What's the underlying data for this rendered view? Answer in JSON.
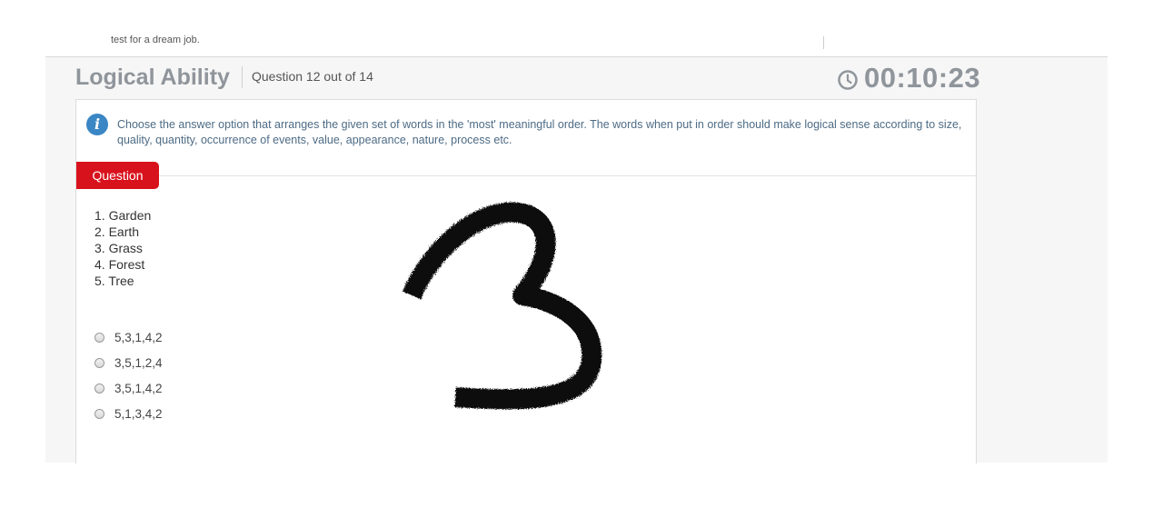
{
  "header": {
    "cut_text": "test for a dream job.",
    "title": "Logical Ability",
    "question_counter": "Question 12 out of 14",
    "timer": "00:10:23",
    "timer_icon": "clock-icon"
  },
  "instructions": {
    "icon": "info-icon",
    "text": "Choose the answer option that arranges the given set of words in the 'most' meaningful order. The words when put in order should make logical sense according to size, quality, quantity, occurrence of events, value, appearance, nature, process etc."
  },
  "question": {
    "tab_label": "Question",
    "words": [
      "1. Garden",
      "2. Earth",
      "3. Grass",
      "4. Forest",
      "5. Tree"
    ],
    "options": [
      "5,3,1,4,2",
      "3,5,1,2,4",
      "3,5,1,4,2",
      "5,1,3,4,2"
    ]
  },
  "overlay": {
    "handwritten_digit": "3"
  },
  "colors": {
    "accent_red": "#d8121d",
    "title_gray": "#8f959b",
    "info_blue": "#3b86c4",
    "info_text": "#4d6b85"
  }
}
